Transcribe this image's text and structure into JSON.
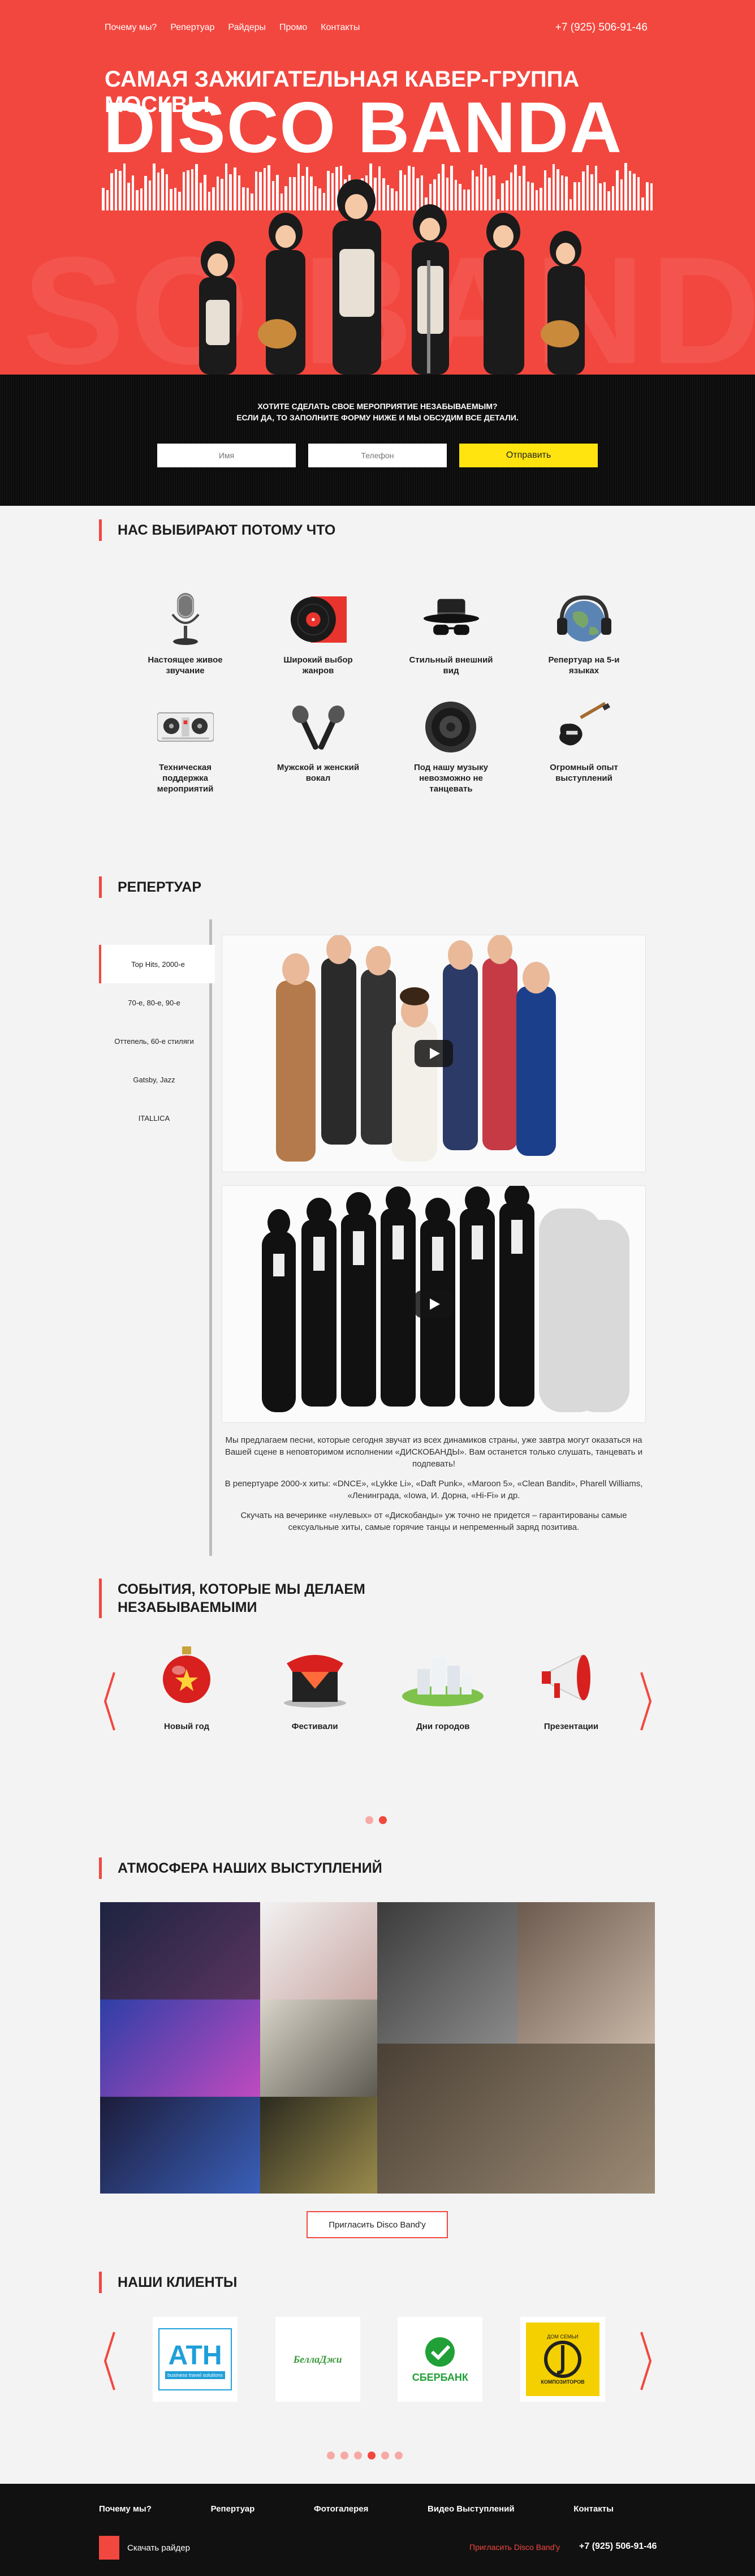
{
  "nav": {
    "items": [
      "Почему мы?",
      "Репертуар",
      "Райдеры",
      "Промо",
      "Контакты"
    ],
    "phone": "+7 (925) 506-91-46"
  },
  "hero": {
    "subtitle": "САМАЯ ЗАЖИГАТЕЛЬНАЯ КАВЕР-ГРУППА МОСКВЫ",
    "title": "DISCO BANDA",
    "watermark": "SO BAND"
  },
  "form": {
    "line1": "Хотите сделать свое мероприятие незабываемым?",
    "line2": "Если да, то заполните форму ниже и мы обсудим все детали.",
    "name_placeholder": "Имя",
    "phone_placeholder": "Телефон",
    "submit_label": "Отправить"
  },
  "why": {
    "heading": "НАС ВЫБИРАЮТ ПОТОМУ ЧТО",
    "items": [
      {
        "label": "Настоящее живое звучание",
        "icon": "microphone-icon"
      },
      {
        "label": "Широкий выбор жанров",
        "icon": "vinyl-record-icon"
      },
      {
        "label": "Стильный внешний вид",
        "icon": "hat-sunglasses-icon"
      },
      {
        "label": "Репертуар на 5-и языках",
        "icon": "globe-headphones-icon"
      },
      {
        "label": "Техническая поддержка мероприятий",
        "icon": "mixer-icon"
      },
      {
        "label": "Мужской и женский вокал",
        "icon": "two-microphones-icon"
      },
      {
        "label": "Под нашу музыку невозможно не танцевать",
        "icon": "speaker-icon"
      },
      {
        "label": "Огромный опыт выступлений",
        "icon": "electric-guitar-icon"
      }
    ]
  },
  "repertoire": {
    "heading": "РЕПЕРТУАР",
    "tabs": [
      "Top Hits, 2000-е",
      "70-е, 80-е, 90-е",
      "Оттепель, 60-е стиляги",
      "Gatsby, Jazz",
      "ITALLICA"
    ],
    "paragraphs": [
      "Мы предлагаем песни, которые сегодня звучат из всех динамиков страны, уже завтра могут оказаться на Вашей сцене в неповторимом исполнении «ДИСКОБАНДЫ». Вам останется только слушать, танцевать и подпевать!",
      "В репертуаре 2000-х хиты: «DNCE», «Lykke Li», «Daft Punk», «Maroon 5», «Clean Bandit», Pharell Williams, «Ленинграда, «Iowa, И. Дорна, «Hi-Fi» и др.",
      "Скучать на вечеринке «нулевых» от «Дискобанды» уж точно не придется – гарантированы самые сексуальные хиты, самые горячие танцы и непременный заряд позитива."
    ]
  },
  "events": {
    "heading_line1": "СОБЫТИЯ, КОТОРЫЕ МЫ ДЕЛАЕМ",
    "heading_line2": "НЕЗАБЫВАЕМЫМИ",
    "items": [
      {
        "label": "Новый год",
        "icon": "christmas-ornament-icon"
      },
      {
        "label": "Фестивали",
        "icon": "festival-tent-icon"
      },
      {
        "label": "Дни городов",
        "icon": "city-buildings-icon"
      },
      {
        "label": "Презентации",
        "icon": "megaphone-icon"
      }
    ]
  },
  "gallery": {
    "heading": "АТМОСФЕРА НАШИХ ВЫСТУПЛЕНИЙ",
    "invite_label": "Пригласить Disco Band'y"
  },
  "clients": {
    "heading": "НАШИ КЛИЕНТЫ",
    "logos": [
      {
        "name": "ATH",
        "tagline": "business travel solutions"
      },
      {
        "name": "БеллаДжи",
        "tagline": ""
      },
      {
        "name": "СБЕРБАНК",
        "tagline": ""
      },
      {
        "name": "КОМПОЗИТОРОВ",
        "tagline": "ДОМ СЕМЬИ"
      }
    ]
  },
  "footer": {
    "nav": [
      "Почему мы?",
      "Репертуар",
      "Фотогалерея",
      "Видео Выступлений",
      "Контакты"
    ],
    "rider_label": "Скачать райдер",
    "invite_label": "Пригласить Disco Band'y",
    "phone": "+7 (925) 506-91-46"
  },
  "colors": {
    "accent": "#f2473f",
    "cta": "#ffe40f",
    "dark": "#0c0c0c"
  }
}
